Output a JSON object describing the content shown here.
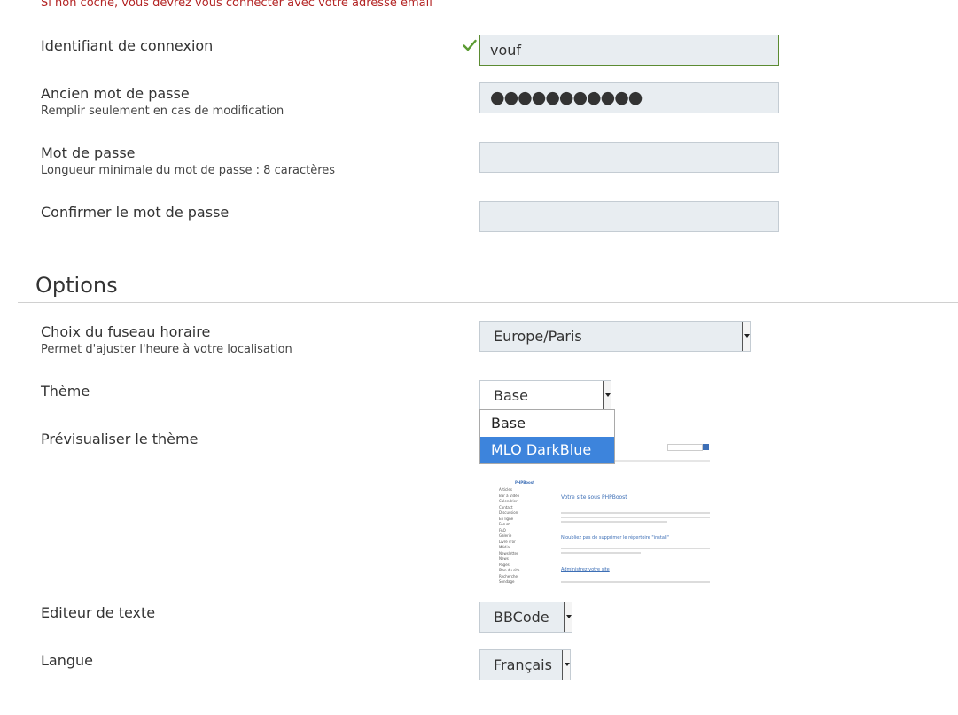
{
  "account": {
    "warning": "Si non coché, vous devrez vous connecter avec votre adresse email",
    "login": {
      "label": "Identifiant de connexion",
      "value": "vouf",
      "valid_icon": "check-icon"
    },
    "old_password": {
      "label": "Ancien mot de passe",
      "help": "Remplir seulement en cas de modification",
      "value": "●●●●●●●●●●●"
    },
    "password": {
      "label": "Mot de passe",
      "help": "Longueur minimale du mot de passe : 8 caractères",
      "value": ""
    },
    "confirm_password": {
      "label": "Confirmer le mot de passe",
      "value": ""
    }
  },
  "options": {
    "title": "Options",
    "timezone": {
      "label": "Choix du fuseau horaire",
      "help": "Permet d'ajuster l'heure à votre localisation",
      "value": "Europe/Paris"
    },
    "theme": {
      "label": "Thème",
      "value": "Base",
      "options": [
        "Base",
        "MLO DarkBlue"
      ],
      "highlighted": "MLO DarkBlue"
    },
    "theme_preview": {
      "label": "Prévisualiser le thème",
      "site_name": "PHPBoost",
      "heading": "Votre site sous PHPBoost",
      "subheading_1": "N'oubliez pas de supprimer le répertoire \"install\"",
      "subheading_2": "Administrez votre site",
      "menu_items": [
        "Articles",
        "Bar à Vidéo",
        "Calendrier",
        "Contact",
        "Discussion",
        "En ligne",
        "Forum",
        "FAQ",
        "Galerie",
        "Livre d'or",
        "Média",
        "Newsletter",
        "News",
        "Pages",
        "Plan du site",
        "Recherche",
        "Sondage"
      ]
    },
    "editor": {
      "label": "Editeur de texte",
      "value": "BBCode"
    },
    "language": {
      "label": "Langue",
      "value": "Français"
    }
  },
  "colors": {
    "accent": "#3d84dc",
    "valid": "#5b9b32",
    "warning": "#b32424"
  }
}
